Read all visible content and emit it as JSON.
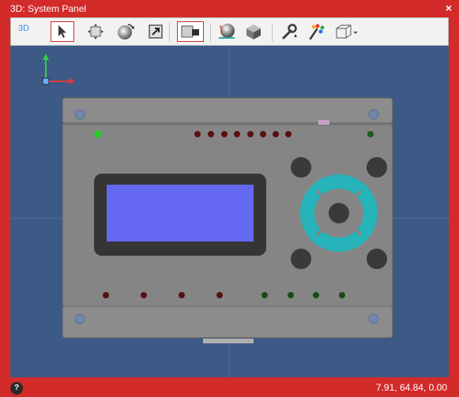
{
  "window": {
    "title": "3D: System Panel",
    "close_glyph": "×"
  },
  "toolbar": {
    "view_mode_label": "3D",
    "tools": [
      {
        "name": "select-tool",
        "icon": "arrow-cursor-icon",
        "selected": true
      },
      {
        "name": "pan-tool",
        "icon": "move-icon",
        "selected": false
      },
      {
        "name": "rotate-tool",
        "icon": "rotate-sphere-icon",
        "selected": false
      },
      {
        "name": "zoom-tool",
        "icon": "zoom-arrow-icon",
        "selected": false
      },
      {
        "name": "board-view-tool",
        "icon": "board-view-icon",
        "selected": true
      },
      {
        "name": "render-sphere-tool",
        "icon": "render-sphere-icon",
        "selected": false
      },
      {
        "name": "solid-view-tool",
        "icon": "solid-cube-icon",
        "selected": false
      },
      {
        "name": "settings-tool",
        "icon": "wrench-icon",
        "selected": false
      },
      {
        "name": "colors-tool",
        "icon": "color-dots-icon",
        "selected": false
      },
      {
        "name": "camera-views-tool",
        "icon": "wire-cube-icon",
        "selected": false
      }
    ]
  },
  "viewport": {
    "background_color": "#3d5a86",
    "lcd_screen_color": "#6467f0",
    "dpad_color": "#26b3ba",
    "panel_color": "#878787"
  },
  "status": {
    "help_glyph": "?",
    "coordinates": "7.91, 64.84, 0.00"
  }
}
